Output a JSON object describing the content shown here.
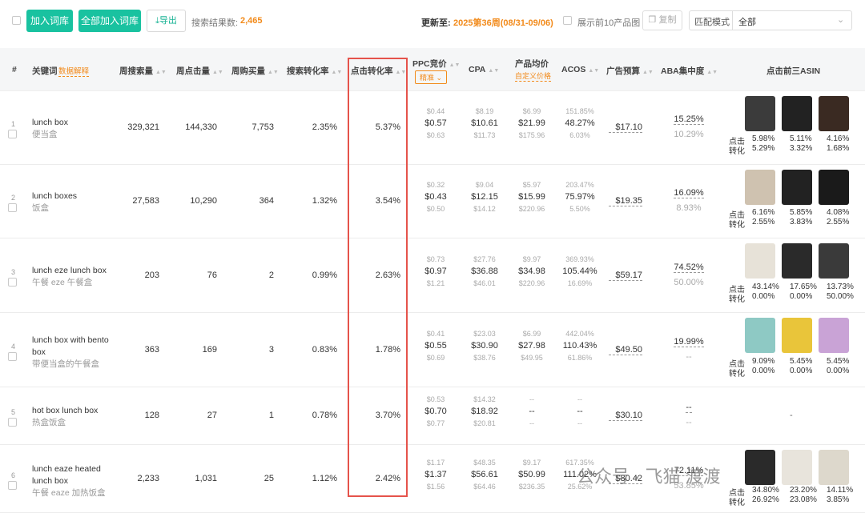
{
  "toolbar": {
    "add_label": "加入词库",
    "add_all_label": "全部加入词库",
    "export_label": "导出",
    "result_label": "搜索结果数:",
    "result_count": "2,465",
    "updated_label": "更新至:",
    "updated_value": "2025第36周(08/31-09/06)",
    "show_top10_label": "展示前10产品图",
    "copy_label": "复制",
    "match_label": "匹配模式",
    "match_value": "全部"
  },
  "header": {
    "index": "#",
    "keyword": "关键词",
    "keyword_hint": "数据解释",
    "weekly_search": "周搜索量",
    "weekly_click": "周点击量",
    "weekly_buy": "周购买量",
    "search_cvr": "搜索转化率",
    "click_cvr": "点击转化率",
    "ppc": "PPC竞价",
    "ppc_mode": "精准",
    "cpa": "CPA",
    "avg_price": "产品均价",
    "avg_price_hint": "自定义价格",
    "acos": "ACOS",
    "ad_budget": "广告预算",
    "aba": "ABA集中度",
    "top3": "点击前三ASIN"
  },
  "labels": {
    "click": "点击",
    "conv": "转化"
  },
  "rows": [
    {
      "idx": "1",
      "kw": "lunch box",
      "cn": "便当盒",
      "search": "329,321",
      "click": "144,330",
      "buy": "7,753",
      "scvr": "2.35%",
      "ccvr": "5.37%",
      "ppc": [
        "$0.44",
        "$0.57",
        "$0.63"
      ],
      "cpa": [
        "$8.19",
        "$10.61",
        "$11.73"
      ],
      "price": [
        "$6.99",
        "$21.99",
        "$175.96"
      ],
      "acos": [
        "151.85%",
        "48.27%",
        "6.03%"
      ],
      "budget": "$17.10",
      "aba": "15.25%",
      "aba2": "10.29%",
      "click_p": [
        "5.98%",
        "5.11%",
        "4.16%"
      ],
      "conv_p": [
        "5.29%",
        "3.32%",
        "1.68%"
      ]
    },
    {
      "idx": "2",
      "kw": "lunch boxes",
      "cn": "饭盒",
      "search": "27,583",
      "click": "10,290",
      "buy": "364",
      "scvr": "1.32%",
      "ccvr": "3.54%",
      "ppc": [
        "$0.32",
        "$0.43",
        "$0.50"
      ],
      "cpa": [
        "$9.04",
        "$12.15",
        "$14.12"
      ],
      "price": [
        "$5.97",
        "$15.99",
        "$220.96"
      ],
      "acos": [
        "203.47%",
        "75.97%",
        "5.50%"
      ],
      "budget": "$19.35",
      "aba": "16.09%",
      "aba2": "8.93%",
      "click_p": [
        "6.16%",
        "5.85%",
        "4.08%"
      ],
      "conv_p": [
        "2.55%",
        "3.83%",
        "2.55%"
      ]
    },
    {
      "idx": "3",
      "kw": "lunch eze lunch box",
      "cn": "午餐 eze 午餐盒",
      "search": "203",
      "click": "76",
      "buy": "2",
      "scvr": "0.99%",
      "ccvr": "2.63%",
      "ppc": [
        "$0.73",
        "$0.97",
        "$1.21"
      ],
      "cpa": [
        "$27.76",
        "$36.88",
        "$46.01"
      ],
      "price": [
        "$9.97",
        "$34.98",
        "$220.96"
      ],
      "acos": [
        "369.93%",
        "105.44%",
        "16.69%"
      ],
      "budget": "$59.17",
      "aba": "74.52%",
      "aba2": "50.00%",
      "click_p": [
        "43.14%",
        "17.65%",
        "13.73%"
      ],
      "conv_p": [
        "0.00%",
        "0.00%",
        "50.00%"
      ]
    },
    {
      "idx": "4",
      "kw": "lunch box with bento box",
      "cn": "带便当盒的午餐盒",
      "search": "363",
      "click": "169",
      "buy": "3",
      "scvr": "0.83%",
      "ccvr": "1.78%",
      "ppc": [
        "$0.41",
        "$0.55",
        "$0.69"
      ],
      "cpa": [
        "$23.03",
        "$30.90",
        "$38.76"
      ],
      "price": [
        "$6.99",
        "$27.98",
        "$49.95"
      ],
      "acos": [
        "442.04%",
        "110.43%",
        "61.86%"
      ],
      "budget": "$49.50",
      "aba": "19.99%",
      "aba2": "--",
      "click_p": [
        "9.09%",
        "5.45%",
        "5.45%"
      ],
      "conv_p": [
        "0.00%",
        "0.00%",
        "0.00%"
      ]
    },
    {
      "idx": "5",
      "kw": "hot box lunch box",
      "cn": "热盒饭盒",
      "search": "128",
      "click": "27",
      "buy": "1",
      "scvr": "0.78%",
      "ccvr": "3.70%",
      "ppc": [
        "$0.53",
        "$0.70",
        "$0.77"
      ],
      "cpa": [
        "$14.32",
        "$18.92",
        "$20.81"
      ],
      "price": [
        "--",
        "--",
        "--"
      ],
      "acos": [
        "--",
        "--",
        "--"
      ],
      "budget": "$30.10",
      "aba": "--",
      "aba2": "--",
      "top3_empty": "-"
    },
    {
      "idx": "6",
      "kw": "lunch eaze heated lunch box",
      "cn": "午餐 eaze 加热饭盒",
      "search": "2,233",
      "click": "1,031",
      "buy": "25",
      "scvr": "1.12%",
      "ccvr": "2.42%",
      "ppc": [
        "$1.17",
        "$1.37",
        "$1.56"
      ],
      "cpa": [
        "$48.35",
        "$56.61",
        "$64.46"
      ],
      "price": [
        "$9.17",
        "$50.99",
        "$236.35"
      ],
      "acos": [
        "617.35%",
        "111.02%",
        "25.62%"
      ],
      "budget": "$80.42",
      "aba": "72.11%",
      "aba2": "53.85%",
      "click_p": [
        "34.80%",
        "23.20%",
        "14.11%"
      ],
      "conv_p": [
        "26.92%",
        "23.08%",
        "3.85%"
      ]
    }
  ],
  "watermark": "公众号 · 飞猫 渡渡"
}
